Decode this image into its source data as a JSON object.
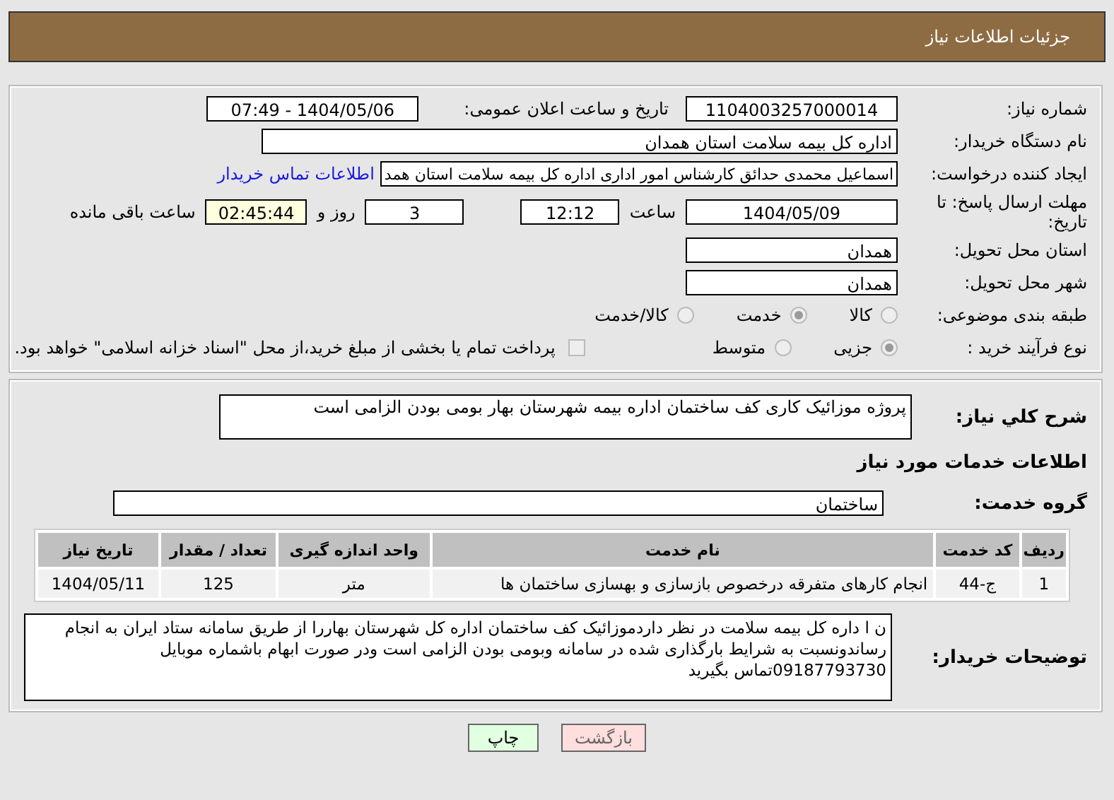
{
  "page_title": "جزئیات اطلاعات نیاز",
  "need_number": {
    "label": "شماره نیاز:",
    "value": "1104003257000014"
  },
  "announce": {
    "label": "تاریخ و ساعت اعلان عمومی:",
    "value": "1404/05/06 - 07:49"
  },
  "buyer": {
    "label": "نام دستگاه خریدار:",
    "value": "اداره کل بیمه سلامت استان همدان"
  },
  "requester": {
    "label": "ایجاد کننده درخواست:",
    "value": "اسماعیل محمدی حدائق کارشناس امور اداری اداره کل بیمه سلامت استان همد",
    "link": "اطلاعات تماس خریدار"
  },
  "deadline": {
    "label": "مهلت ارسال پاسخ: تا تاریخ:",
    "date": "1404/05/09",
    "time_label": "ساعت",
    "time": "12:12",
    "days": "3",
    "days_label": "روز و",
    "remaining": "02:45:44",
    "remaining_label": "ساعت باقی مانده"
  },
  "province": {
    "label": "استان محل تحویل:",
    "value": "همدان"
  },
  "city": {
    "label": "شهر محل تحویل:",
    "value": "همدان"
  },
  "category": {
    "label": "طبقه بندی موضوعی:",
    "options": [
      {
        "label": "کالا",
        "selected": false
      },
      {
        "label": "خدمت",
        "selected": true
      },
      {
        "label": "کالا/خدمت",
        "selected": false
      }
    ]
  },
  "process": {
    "label": "نوع فرآیند خرید :",
    "options": [
      {
        "label": "جزیی",
        "selected": true
      },
      {
        "label": "متوسط",
        "selected": false
      }
    ],
    "payment": {
      "checked": false,
      "text": "پرداخت تمام یا بخشی از مبلغ خرید،از محل \"اسناد خزانه اسلامی\" خواهد بود."
    }
  },
  "summary": {
    "label": "شرح کلي نياز:",
    "value": "پروژه موزائیک کاری کف ساختمان اداره بیمه شهرستان بهار بومی بودن الزامی است"
  },
  "services_heading": "اطلاعات خدمات مورد نیاز",
  "service_group": {
    "label": "گروه خدمت:",
    "value": "ساختمان"
  },
  "table": {
    "columns": [
      "ردیف",
      "کد خدمت",
      "نام خدمت",
      "واحد اندازه گیری",
      "تعداد / مقدار",
      "تاریخ نیاز"
    ],
    "rows": [
      [
        "1",
        "ج-44",
        "انجام کارهای متفرقه درخصوص بازسازی و بهسازی ساختمان ها",
        "متر",
        "125",
        "1404/05/11"
      ]
    ]
  },
  "buyer_notes": {
    "label": "توضیحات خریدار:",
    "value": "ن ا داره کل بیمه سلامت در نظر داردموزائیک کف ساختمان اداره کل شهرستان بهاررا از طریق سامانه ستاد ایران به انجام رساندونسبت به شرایط بارگذاری شده در سامانه وبومی بودن الزامی است ودر صورت ابهام باشماره موبایل 09187793730تماس بگیرید"
  },
  "buttons": [
    {
      "label": "بازگشت",
      "kind": "back"
    },
    {
      "label": "چاپ",
      "kind": "print"
    }
  ]
}
